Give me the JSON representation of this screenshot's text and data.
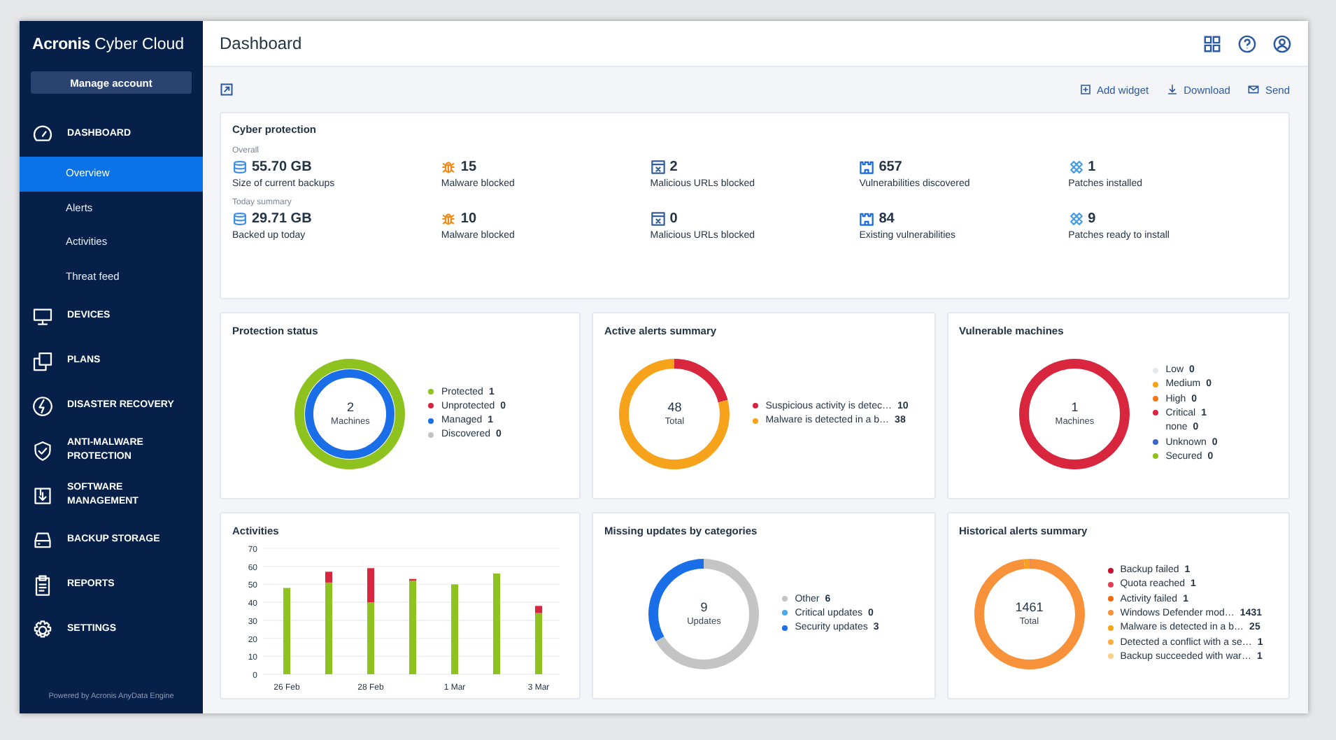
{
  "sidebar": {
    "logo": {
      "brand": "Acronis",
      "product": "Cyber Cloud"
    },
    "manage_button": "Manage account",
    "items": [
      {
        "label": "DASHBOARD",
        "children": [
          {
            "label": "Overview",
            "selected": true
          },
          {
            "label": "Alerts",
            "selected": false
          },
          {
            "label": "Activities",
            "selected": false
          },
          {
            "label": "Threat feed",
            "selected": false
          }
        ]
      },
      {
        "label": "DEVICES"
      },
      {
        "label": "PLANS"
      },
      {
        "label": "DISASTER RECOVERY"
      },
      {
        "label": "ANTI-MALWARE PROTECTION"
      },
      {
        "label": "SOFTWARE MANAGEMENT"
      },
      {
        "label": "BACKUP STORAGE"
      },
      {
        "label": "REPORTS"
      },
      {
        "label": "SETTINGS"
      }
    ],
    "footer": "Powered by Acronis AnyData Engine"
  },
  "header": {
    "title": "Dashboard"
  },
  "toolbar": {
    "actions": [
      "Add widget",
      "Download",
      "Send"
    ]
  },
  "cyber_protection": {
    "title": "Cyber protection",
    "sections": [
      {
        "label": "Overall",
        "stats": [
          {
            "value": "55.70 GB",
            "label": "Size of current backups"
          },
          {
            "value": "15",
            "label": "Malware blocked"
          },
          {
            "value": "2",
            "label": "Malicious URLs blocked"
          },
          {
            "value": "657",
            "label": "Vulnerabilities discovered"
          },
          {
            "value": "1",
            "label": "Patches installed"
          }
        ]
      },
      {
        "label": "Today summary",
        "stats": [
          {
            "value": "29.71 GB",
            "label": "Backed up today"
          },
          {
            "value": "10",
            "label": "Malware blocked"
          },
          {
            "value": "0",
            "label": "Malicious URLs blocked"
          },
          {
            "value": "84",
            "label": "Existing vulnerabilities"
          },
          {
            "value": "9",
            "label": "Patches ready to install"
          }
        ]
      }
    ]
  },
  "widgets": [
    {
      "kind": "donut",
      "title": "Protection status",
      "center": {
        "value": "2",
        "label": "Machines"
      },
      "legend": [
        {
          "label": "Protected",
          "value": "1",
          "color": "#8dc21f",
          "kind": "outer"
        },
        {
          "label": "Unprotected",
          "value": "0",
          "color": "#d7263d",
          "kind": "outer"
        },
        {
          "label": "Managed",
          "value": "1",
          "color": "#1a6fe8",
          "kind": "inner"
        },
        {
          "label": "Discovered",
          "value": "0",
          "color": "#c4c4c4",
          "kind": "inner"
        }
      ]
    },
    {
      "kind": "donut",
      "title": "Active alerts summary",
      "center": {
        "value": "48",
        "label": "Total"
      },
      "legend": [
        {
          "label": "Suspicious activity is detec…",
          "value": "10",
          "color": "#d7263d"
        },
        {
          "label": "Malware is detected in a b…",
          "value": "38",
          "color": "#f7a21b"
        }
      ]
    },
    {
      "kind": "donut",
      "title": "Vulnerable machines",
      "center": {
        "value": "1",
        "label": "Machines"
      },
      "legend": [
        {
          "label": "Low",
          "value": "0",
          "color": "#e3e8f0"
        },
        {
          "label": "Medium",
          "value": "0",
          "color": "#f7a21b"
        },
        {
          "label": "High",
          "value": "0",
          "color": "#f5761a"
        },
        {
          "label": "Critical",
          "value": "1",
          "color": "#d7263d"
        },
        {
          "label": "none",
          "value": "0"
        },
        {
          "label": "Unknown",
          "value": "0",
          "color": "#3a67c4"
        },
        {
          "label": "Secured",
          "value": "0",
          "color": "#8dc21f"
        }
      ]
    },
    {
      "kind": "bar",
      "title": "Activities",
      "chart_data": {
        "type": "bar",
        "stacked": true,
        "categories": [
          "26 Feb",
          null,
          "28 Feb",
          null,
          "1 Mar",
          null,
          "3 Mar"
        ],
        "grid": true,
        "ylim": [
          0,
          70
        ],
        "yticks": [
          0,
          10,
          20,
          30,
          40,
          50,
          60,
          70
        ],
        "series": [
          {
            "color": "#8dc21f",
            "values": [
              48,
              51,
              40,
              52,
              50,
              56,
              34
            ]
          },
          {
            "color": "#d7263d",
            "values": [
              0,
              6,
              19,
              1,
              0,
              0,
              4
            ]
          }
        ]
      }
    },
    {
      "kind": "donut",
      "title": "Missing updates by categories",
      "center": {
        "value": "9",
        "label": "Updates"
      },
      "legend": [
        {
          "label": "Other",
          "value": "6",
          "color": "#c4c4c4"
        },
        {
          "label": "Critical updates",
          "value": "0",
          "color": "#46a8f0"
        },
        {
          "label": "Security updates",
          "value": "3",
          "color": "#1a6fe8"
        }
      ]
    },
    {
      "kind": "donut",
      "title": "Historical alerts summary",
      "center": {
        "value": "1461",
        "label": "Total"
      },
      "legend": [
        {
          "label": "Backup failed",
          "value": "1",
          "color": "#c8102e"
        },
        {
          "label": "Quota reached",
          "value": "1",
          "color": "#e0405a"
        },
        {
          "label": "Activity failed",
          "value": "1",
          "color": "#f06a10"
        },
        {
          "label": "Windows Defender mod…",
          "value": "1431",
          "color": "#f7913a"
        },
        {
          "label": "Malware is detected in a b…",
          "value": "25",
          "color": "#f7a21b"
        },
        {
          "label": "Detected a conflict with a se…",
          "value": "1",
          "color": "#fbb040"
        },
        {
          "label": "Backup succeeded with war…",
          "value": "1",
          "color": "#fdd08a"
        }
      ]
    }
  ]
}
